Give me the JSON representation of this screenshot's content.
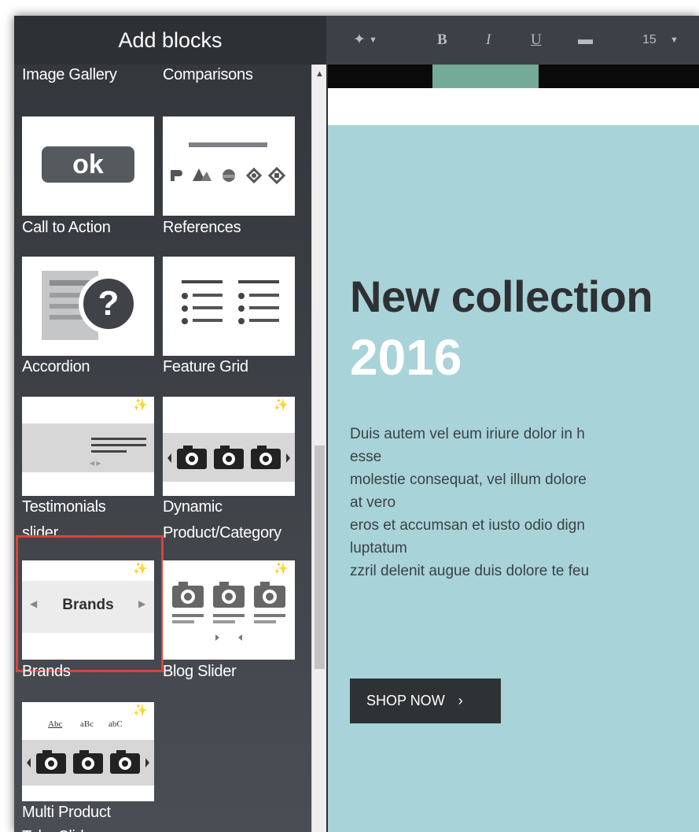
{
  "panel": {
    "title": "Add blocks",
    "partial_labels": [
      "Image Gallery",
      "Comparisons"
    ],
    "blocks": [
      {
        "label": "Call to Action",
        "button_text": "ok"
      },
      {
        "label": "References"
      },
      {
        "label": "Accordion"
      },
      {
        "label": "Feature Grid"
      },
      {
        "label_line1": "Testimonials",
        "label_line2": "slider"
      },
      {
        "label_line1": "Dynamic",
        "label_line2": "Product/Category"
      },
      {
        "label": "Brands",
        "tile_text": "Brands",
        "selected": true
      },
      {
        "label": "Blog Slider"
      },
      {
        "label_line1": "Multi Product",
        "label_line2": "Tabs Slider",
        "tabs": [
          "Abc",
          "aBc",
          "abC"
        ]
      }
    ],
    "new_badge_color": "#e89a3c",
    "selection_color": "#d9443b"
  },
  "toolbar": {
    "magic_icon": "magic-wand-icon",
    "bold": "B",
    "italic": "I",
    "underline": "U",
    "eraser_icon": "eraser-icon",
    "font_size": "15"
  },
  "canvas": {
    "heading": "New collection",
    "year": "2016",
    "paragraph_lines": [
      "Duis autem vel eum iriure dolor in h",
      "esse",
      "molestie consequat, vel illum dolore",
      "at vero",
      "eros et accumsan et iusto odio dign",
      "luptatum",
      "zzril delenit augue duis dolore te feu"
    ],
    "button": "SHOP NOW",
    "background_color": "#a8d3d9"
  }
}
